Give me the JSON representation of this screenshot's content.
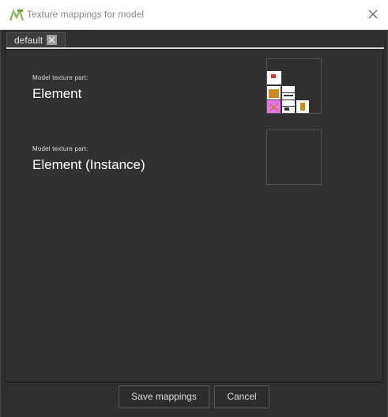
{
  "window": {
    "title": "Texture mappings for model"
  },
  "tabs": [
    {
      "label": "default"
    }
  ],
  "parts": [
    {
      "caption": "Model texture part:",
      "name": "Element"
    },
    {
      "caption": "Model texture part:",
      "name": "Element (Instance)"
    }
  ],
  "footer": {
    "save_label": "Save mappings",
    "cancel_label": "Cancel"
  },
  "colors": {
    "accent_green": "#7bbf3a",
    "texture_pink": "#f06ef0",
    "texture_orange": "#d08a1c"
  }
}
